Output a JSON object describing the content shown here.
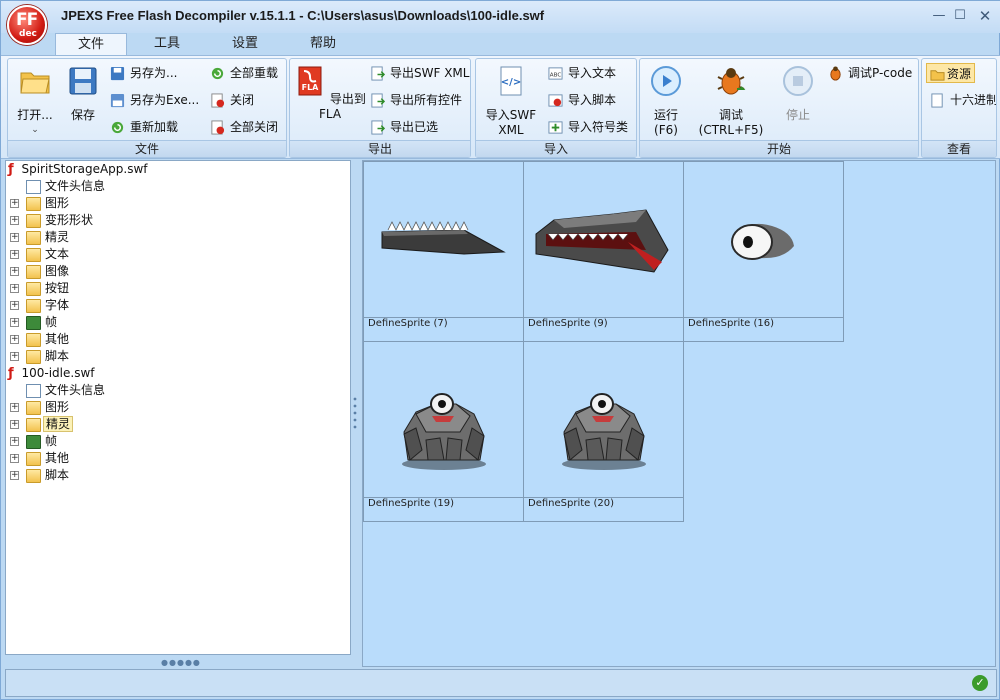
{
  "window": {
    "title": "JPEXS Free Flash Decompiler v.15.1.1 - C:\\Users\\asus\\Downloads\\100-idle.swf",
    "logo_text": "FF",
    "logo_sub": "dec"
  },
  "menu_tabs": [
    "文件",
    "工具",
    "设置",
    "帮助"
  ],
  "ribbon": {
    "file": {
      "label": "文件",
      "open": "打开...",
      "save": "保存",
      "save_as": "另存为...",
      "save_as_exe": "另存为Exe...",
      "reload": "重新加载",
      "reload_all": "全部重载",
      "close": "关闭",
      "close_all": "全部关闭"
    },
    "export": {
      "label": "导出",
      "export_fla": "导出到FLA",
      "export_swf_xml": "导出SWF XML",
      "export_all": "导出所有控件",
      "export_selected": "导出已选"
    },
    "import": {
      "label": "导入",
      "import_swf_xml_1": "导入SWF",
      "import_swf_xml_2": "XML",
      "import_text": "导入文本",
      "import_script": "导入脚本",
      "import_symbol": "导入符号类"
    },
    "start": {
      "label": "开始",
      "run": "运行",
      "run_key": "(F6)",
      "debug": "调试",
      "debug_key": "(CTRL+F5)",
      "stop": "停止",
      "debug_pcode": "调试P-code"
    },
    "view": {
      "label": "查看",
      "resources": "资源",
      "hex": "十六进制"
    }
  },
  "tree": {
    "swf1": {
      "name": "SpiritStorageApp.swf",
      "items": [
        "文件头信息",
        "图形",
        "变形形状",
        "精灵",
        "文本",
        "图像",
        "按钮",
        "字体",
        "帧",
        "其他",
        "脚本"
      ]
    },
    "swf2": {
      "name": "100-idle.swf",
      "items": [
        "文件头信息",
        "图形",
        "精灵",
        "帧",
        "其他",
        "脚本"
      ]
    }
  },
  "thumbnails": [
    {
      "caption": "DefineSprite (7)",
      "art": "spiked-bar"
    },
    {
      "caption": "DefineSprite (9)",
      "art": "jaw-head"
    },
    {
      "caption": "DefineSprite (16)",
      "art": "eye"
    },
    {
      "caption": "DefineSprite (19)",
      "art": "rock-golem"
    },
    {
      "caption": "DefineSprite (20)",
      "art": "rock-golem"
    }
  ],
  "status": {
    "icon": "ok-check-icon"
  }
}
